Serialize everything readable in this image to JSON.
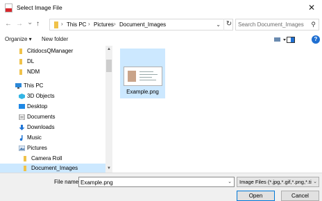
{
  "window": {
    "title": "Select Image File",
    "close_glyph": "✕"
  },
  "nav": {
    "back_glyph": "←",
    "forward_glyph": "→",
    "history_glyph": "⌄",
    "up_glyph": "↑",
    "breadcrumb": [
      "This PC",
      "Pictures",
      "Document_Images"
    ],
    "separator": "›",
    "address_dropdown_glyph": "⌄",
    "refresh_glyph": "↻",
    "search_placeholder": "Search Document_Images",
    "search_glyph": "⚲"
  },
  "toolbar": {
    "organize_label": "Organize ▾",
    "new_folder_label": "New folder",
    "help_label": "?"
  },
  "tree": {
    "items": [
      {
        "label": "CitidocsQManager",
        "icon": "folder-icon"
      },
      {
        "label": "DL",
        "icon": "folder-icon"
      },
      {
        "label": "NDM",
        "icon": "folder-icon"
      },
      {
        "label": "This PC",
        "icon": "computer-icon"
      },
      {
        "label": "3D Objects",
        "icon": "cube-icon"
      },
      {
        "label": "Desktop",
        "icon": "desktop-icon"
      },
      {
        "label": "Documents",
        "icon": "document-icon"
      },
      {
        "label": "Downloads",
        "icon": "download-icon"
      },
      {
        "label": "Music",
        "icon": "music-icon"
      },
      {
        "label": "Pictures",
        "icon": "pictures-icon"
      },
      {
        "label": "Camera Roll",
        "icon": "folder-icon"
      },
      {
        "label": "Document_Images",
        "icon": "folder-icon"
      }
    ]
  },
  "files": [
    {
      "name": "Example.png",
      "icon": "image-file-icon"
    }
  ],
  "bottom": {
    "file_name_label": "File name:",
    "file_name_value": "Example.png",
    "filter_value": "Image Files (*.jpg,*.gif,*.png,*.tif",
    "dropdown_glyph": "⌄",
    "open_label": "Open",
    "cancel_label": "Cancel"
  },
  "colors": {
    "accent": "#0078d7",
    "selection": "#cce8ff",
    "folder": "#f0c24a"
  }
}
